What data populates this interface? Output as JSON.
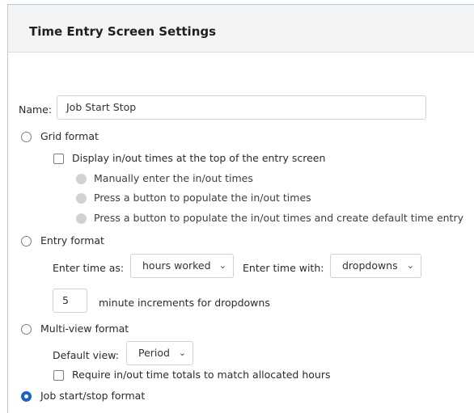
{
  "title": "Time Entry Screen Settings",
  "name_field": {
    "label": "Name:",
    "value": "Job Start Stop"
  },
  "grid_format": {
    "label": "Grid format",
    "display_inout_label": "Display in/out times at the top of the entry screen",
    "sub_options": [
      "Manually enter the in/out times",
      "Press a button to populate the in/out times",
      "Press a button to populate the in/out times and create default time entry"
    ]
  },
  "entry_format": {
    "label": "Entry format",
    "enter_time_as_label": "Enter time as:",
    "enter_time_as_value": "hours worked",
    "enter_time_with_label": "Enter time with:",
    "enter_time_with_value": "dropdowns",
    "increment_value": "5",
    "increment_label": "minute increments for dropdowns"
  },
  "multiview_format": {
    "label": "Multi-view format",
    "default_view_label": "Default view:",
    "default_view_value": "Period",
    "require_totals_label": "Require in/out time totals to match allocated hours"
  },
  "job_format": {
    "label": "Job start/stop format",
    "selected": true
  },
  "icons": {
    "chevron": "chevron-down-icon"
  },
  "colors": {
    "accent": "#1b62c4",
    "header_bg": "#f3f4f6",
    "disabled": "#cfd1d4"
  }
}
